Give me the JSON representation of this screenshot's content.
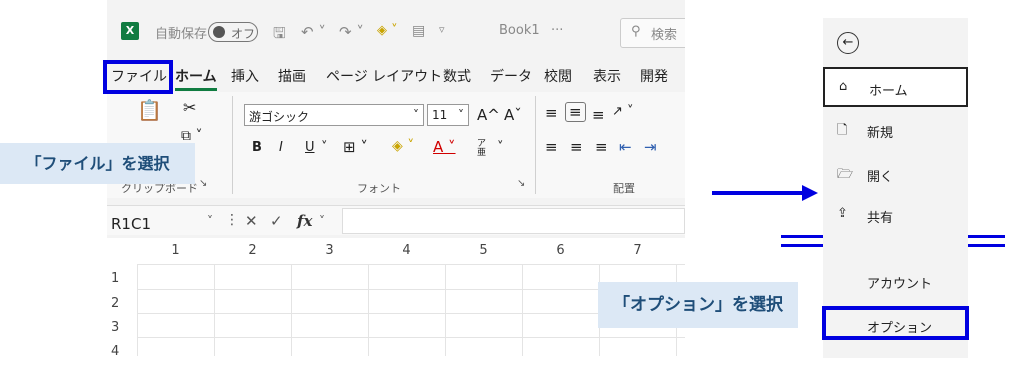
{
  "excel": {
    "title_bar": {
      "app_icon": "X",
      "autosave_label": "自動保存",
      "autosave_state": "オフ",
      "file_name": "Book1",
      "file_suffix": "···",
      "search_label": "検索"
    },
    "menu_tabs": [
      "ファイル",
      "ホーム",
      "挿入",
      "描画",
      "ページ レイアウト",
      "数式",
      "データ",
      "校閲",
      "表示",
      "開発"
    ],
    "ribbon": {
      "font_name": "游ゴシック",
      "font_size": "11",
      "clipboard_label": "クリップボード",
      "font_group_label": "フォント",
      "alignment_group_label": "配置",
      "bold": "B",
      "italic": "I",
      "underline": "U",
      "furigana": "ア亜",
      "grow_font": "A^",
      "shrink_font": "Aˇ"
    },
    "formula_bar": {
      "name_box": "R1C1",
      "fx": "fx"
    },
    "columns": [
      "1",
      "2",
      "3",
      "4",
      "5",
      "6",
      "7"
    ],
    "rows": [
      "1",
      "2",
      "3",
      "4"
    ]
  },
  "callouts": {
    "file_select": "「ファイル」を選択",
    "options_select": "「オプション」を選択"
  },
  "file_panel": {
    "back_icon": "back-arrow-icon",
    "items": [
      {
        "icon": "home-icon",
        "label": "ホーム"
      },
      {
        "icon": "new-file-icon",
        "label": "新規"
      },
      {
        "icon": "open-folder-icon",
        "label": "開く"
      },
      {
        "icon": "share-icon",
        "label": "共有"
      }
    ],
    "account": "アカウント",
    "options": "オプション"
  },
  "colors": {
    "highlight": "#0000e0",
    "callout_bg": "#dce8f5",
    "callout_text": "#1f4e79",
    "excel_green": "#107c41"
  }
}
